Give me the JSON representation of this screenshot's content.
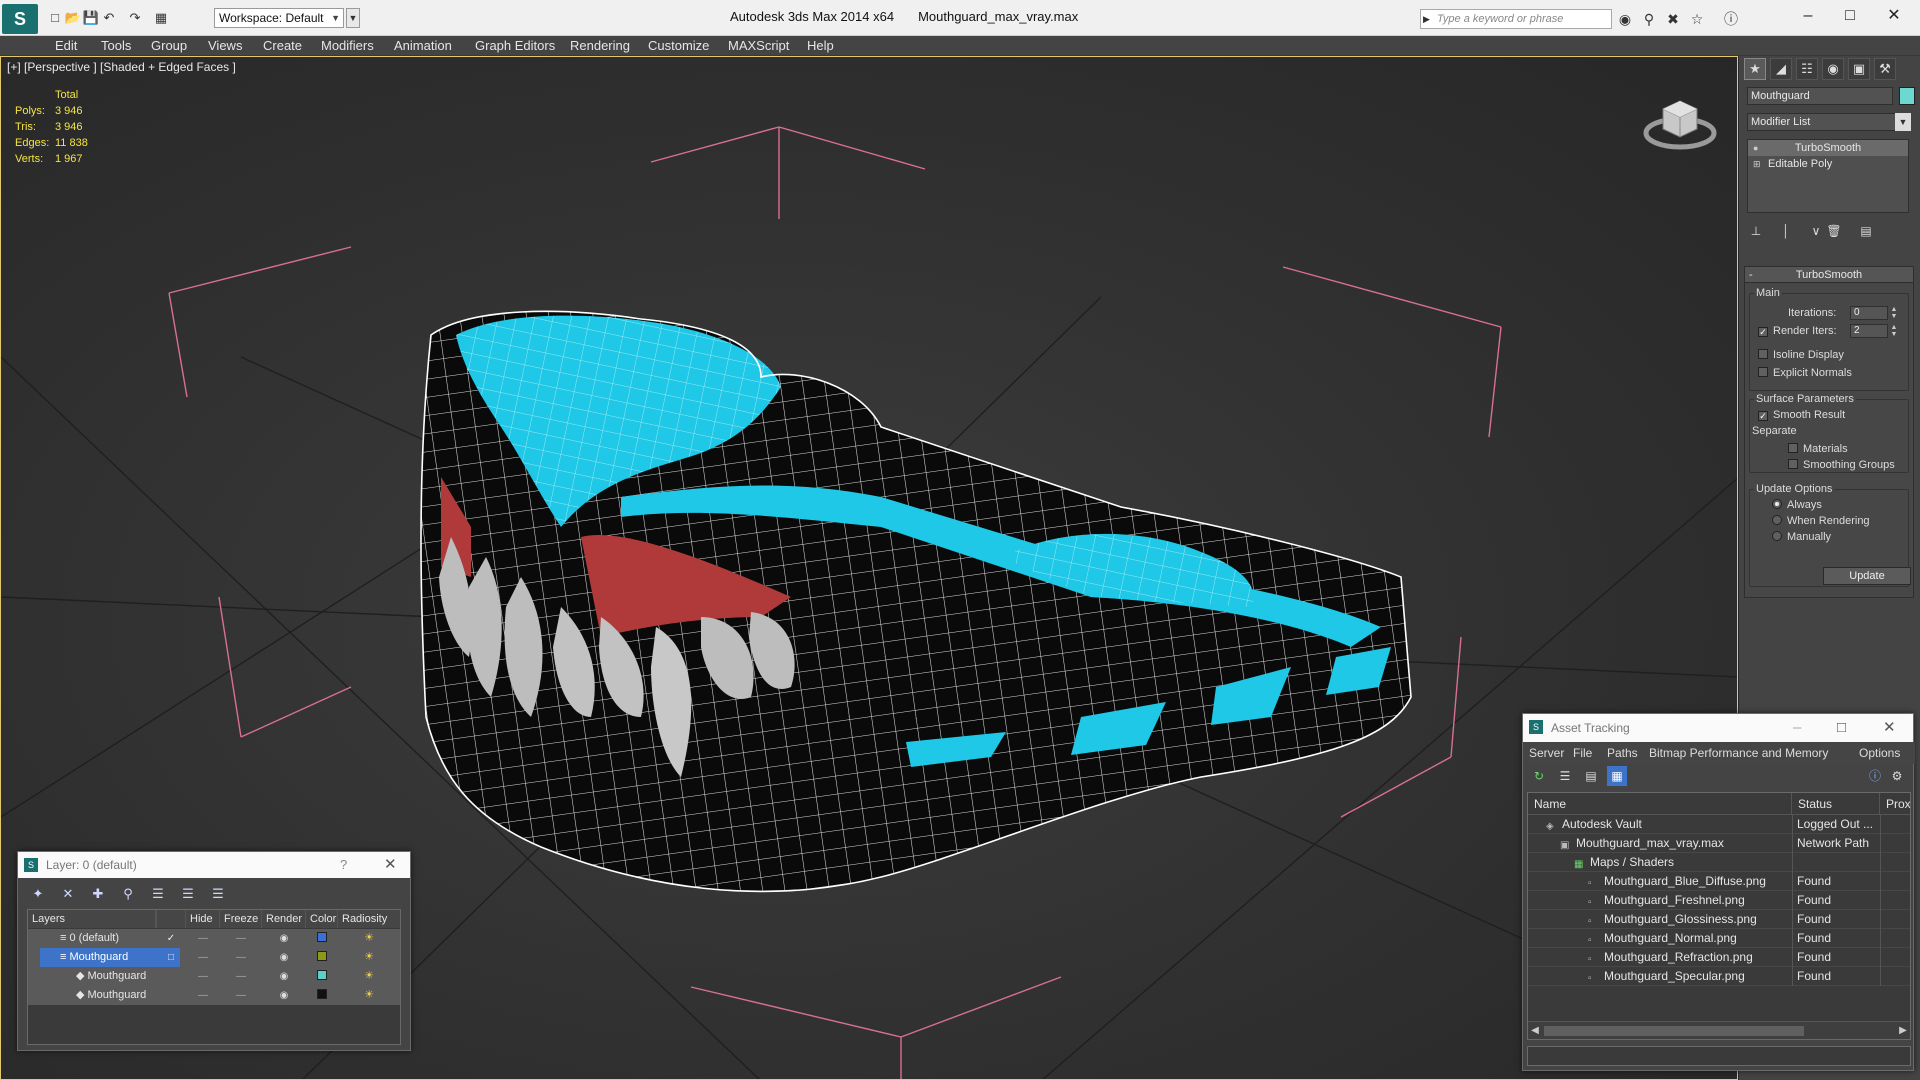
{
  "titlebar": {
    "app_title": "Autodesk 3ds Max  2014 x64",
    "file_title": "Mouthguard_max_vray.max",
    "workspace_label": "Workspace: Default",
    "search_placeholder": "Type a keyword or phrase",
    "logo_text": "S"
  },
  "menu": [
    "Edit",
    "Tools",
    "Group",
    "Views",
    "Create",
    "Modifiers",
    "Animation",
    "Graph Editors",
    "Rendering",
    "Customize",
    "MAXScript",
    "Help"
  ],
  "viewport": {
    "label": "[+] [Perspective ] [Shaded + Edged Faces ]",
    "stats_header": "Total",
    "stats": [
      {
        "label": "Polys:",
        "value": "3 946"
      },
      {
        "label": "Tris:",
        "value": "3 946"
      },
      {
        "label": "Edges:",
        "value": "11 838"
      },
      {
        "label": "Verts:",
        "value": "1 967"
      }
    ]
  },
  "command_panel": {
    "object_name": "Mouthguard",
    "object_color": "#6cd8d0",
    "modifier_list": "Modifier List",
    "stack": [
      "TurboSmooth",
      "Editable Poly"
    ],
    "rollout_title": "TurboSmooth",
    "main_group": "Main",
    "iterations_label": "Iterations:",
    "iterations_value": "0",
    "render_iters_label": "Render Iters:",
    "render_iters_value": "2",
    "isoline_label": "Isoline Display",
    "explicit_normals_label": "Explicit Normals",
    "surface_group": "Surface Parameters",
    "smooth_result_label": "Smooth Result",
    "separate_label": "Separate",
    "materials_label": "Materials",
    "smoothing_groups_label": "Smoothing Groups",
    "update_group": "Update Options",
    "update_always": "Always",
    "update_when_rendering": "When Rendering",
    "update_manually": "Manually",
    "update_button": "Update",
    "render_iters_checked": true,
    "smooth_result_checked": true
  },
  "layer_dialog": {
    "title": "Layer: 0 (default)",
    "help": "?",
    "columns": [
      "Layers",
      "Hide",
      "Freeze",
      "Render",
      "Color",
      "Radiosity"
    ],
    "rows": [
      {
        "name": "0 (default)",
        "color": "#3a6fd8"
      },
      {
        "name": "Mouthguard",
        "color": "#8a9a18"
      },
      {
        "name": "Mouthguard",
        "color": "#5ad0c8"
      },
      {
        "name": "Mouthguard",
        "color": "#111111"
      }
    ]
  },
  "asset_dialog": {
    "title": "Asset Tracking",
    "menu": [
      "Server",
      "File",
      "Paths",
      "Bitmap Performance and Memory",
      "Options"
    ],
    "columns": [
      "Name",
      "Status",
      "Proxy"
    ],
    "rows": [
      {
        "name": "Autodesk Vault",
        "status": "Logged Out ..."
      },
      {
        "name": "Mouthguard_max_vray.max",
        "status": "Network Path"
      },
      {
        "name": "Maps / Shaders",
        "status": ""
      },
      {
        "name": "Mouthguard_Blue_Diffuse.png",
        "status": "Found"
      },
      {
        "name": "Mouthguard_Freshnel.png",
        "status": "Found"
      },
      {
        "name": "Mouthguard_Glossiness.png",
        "status": "Found"
      },
      {
        "name": "Mouthguard_Normal.png",
        "status": "Found"
      },
      {
        "name": "Mouthguard_Refraction.png",
        "status": "Found"
      },
      {
        "name": "Mouthguard_Specular.png",
        "status": "Found"
      }
    ]
  },
  "colors": {
    "accent_blue": "#3d73c8",
    "mouthguard_cyan": "#1ec8e6",
    "bbox_pink": "#d87090",
    "stats_yellow": "#f4e542"
  }
}
